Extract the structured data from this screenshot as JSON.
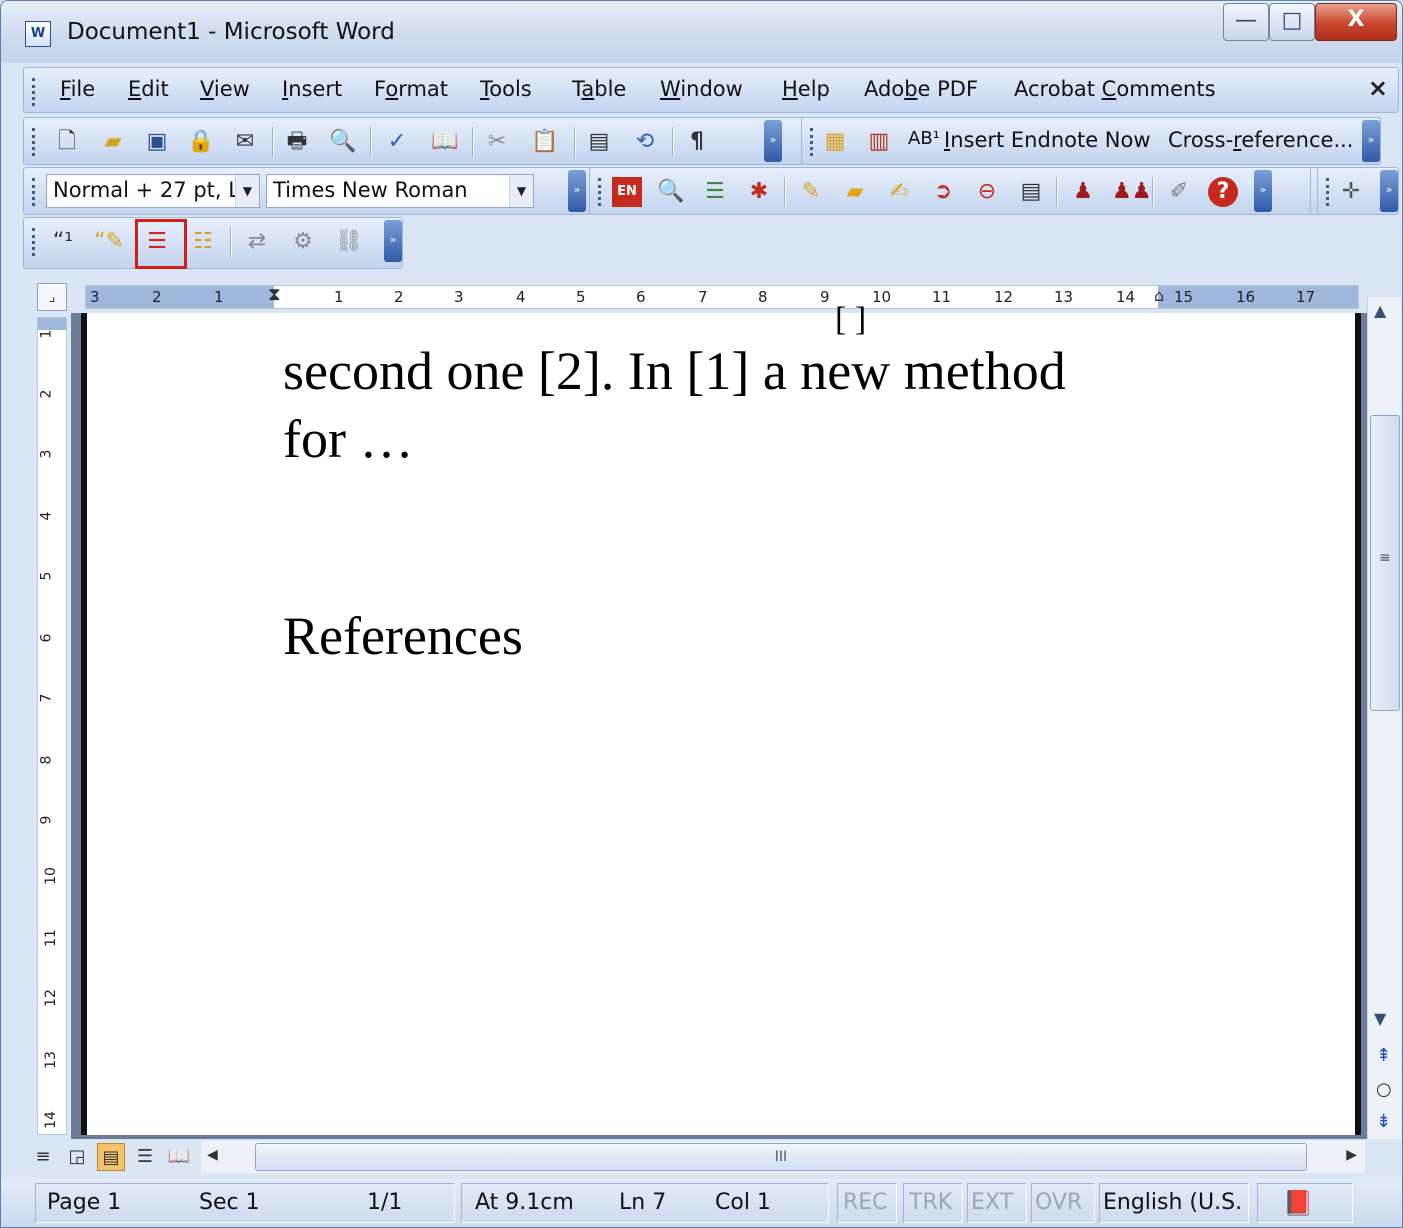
{
  "window": {
    "title": "Document1 - Microsoft Word",
    "app_icon": "word-doc-icon"
  },
  "menubar": {
    "items": [
      {
        "label": "File",
        "u": "F",
        "rest": "ile"
      },
      {
        "label": "Edit",
        "u": "E",
        "rest": "dit"
      },
      {
        "label": "View",
        "u": "V",
        "rest": "iew"
      },
      {
        "label": "Insert",
        "u": "I",
        "rest": "nsert"
      },
      {
        "label": "Format",
        "pre": "F",
        "u": "o",
        "rest": "rmat"
      },
      {
        "label": "Tools",
        "u": "T",
        "rest": "ools"
      },
      {
        "label": "Table",
        "pre": "T",
        "u": "a",
        "rest": "ble"
      },
      {
        "label": "Window",
        "u": "W",
        "rest": "indow"
      },
      {
        "label": "Help",
        "u": "H",
        "rest": "elp"
      },
      {
        "label": "Adobe PDF",
        "pre": "Ado",
        "u": "b",
        "rest": "e PDF"
      },
      {
        "label": "Acrobat Comments",
        "pre": "Acrobat ",
        "u": "C",
        "rest": "omments"
      }
    ],
    "close_glyph": "×"
  },
  "toolbar1": {
    "insert_endnote_label": "Insert Endnote Now",
    "insert_endnote_u": "I",
    "cross_reference_label": "Cross-reference...",
    "cross_pre": "Cross-",
    "cross_u": "r",
    "cross_rest": "eference...",
    "ab_label": "AB¹"
  },
  "toolbar2": {
    "style_value": "Normal + 27 pt, L",
    "font_value": "Times New Roman"
  },
  "ruler": {
    "h_left": [
      "3",
      "2",
      "1"
    ],
    "h_right": [
      "1",
      "2",
      "3",
      "4",
      "5",
      "6",
      "7",
      "8",
      "9",
      "10",
      "11",
      "12",
      "13",
      "14",
      "15",
      "16",
      "17"
    ],
    "v_numbers": [
      "1",
      "2",
      "3",
      "4",
      "5",
      "6",
      "7",
      "8",
      "9",
      "10",
      "11",
      "12",
      "13",
      "14"
    ]
  },
  "document": {
    "para_line1": "second one [2]. In [1] a new method",
    "para_line2": "for …",
    "top_fragment": "[  ]",
    "heading": "References"
  },
  "hscroll": {
    "grip": "III"
  },
  "status": {
    "page": "Page 1",
    "sec": "Sec 1",
    "pages": "1/1",
    "at": "At 9.1cm",
    "ln": "Ln 7",
    "col": "Col 1",
    "rec": "REC",
    "trk": "TRK",
    "ext": "EXT",
    "ovr": "OVR",
    "language": "English (U.S.",
    "spell_icon": "spelling-book-icon"
  }
}
